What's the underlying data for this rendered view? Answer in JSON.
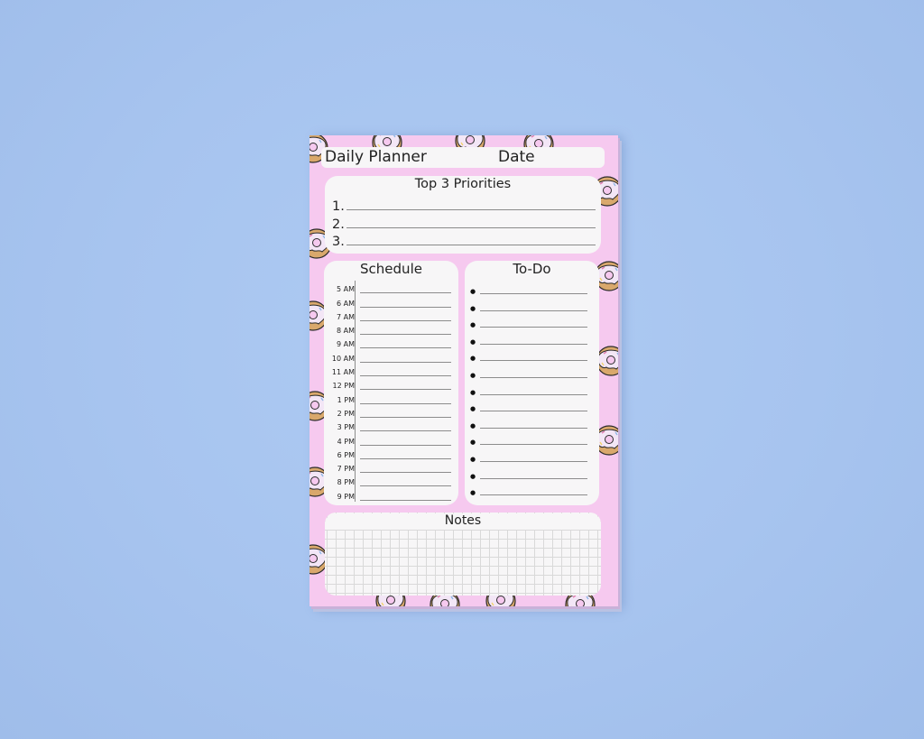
{
  "planner": {
    "title": "Daily Planner",
    "date_label": "Date",
    "priorities": {
      "heading": "Top 3 Priorities",
      "items": [
        "1.",
        "2.",
        "3."
      ]
    },
    "schedule": {
      "heading": "Schedule",
      "times": [
        "5 AM",
        "6 AM",
        "7 AM",
        "8 AM",
        "9 AM",
        "10 AM",
        "11 AM",
        "12 PM",
        "1 PM",
        "2 PM",
        "3 PM",
        "4 PM",
        "6 PM",
        "7 PM",
        "8 PM",
        "9 PM"
      ]
    },
    "todo": {
      "heading": "To-Do",
      "bullet_count": 13
    },
    "notes": {
      "heading": "Notes"
    }
  },
  "colors": {
    "background": "#a8c5f0",
    "pad_pink": "#f6c9ef",
    "card": "#f7f6f7",
    "donut_icing": "#f3e6f6",
    "donut_dough": "#d9a86c"
  },
  "decorations": {
    "pattern_icon": "donut-icon"
  }
}
